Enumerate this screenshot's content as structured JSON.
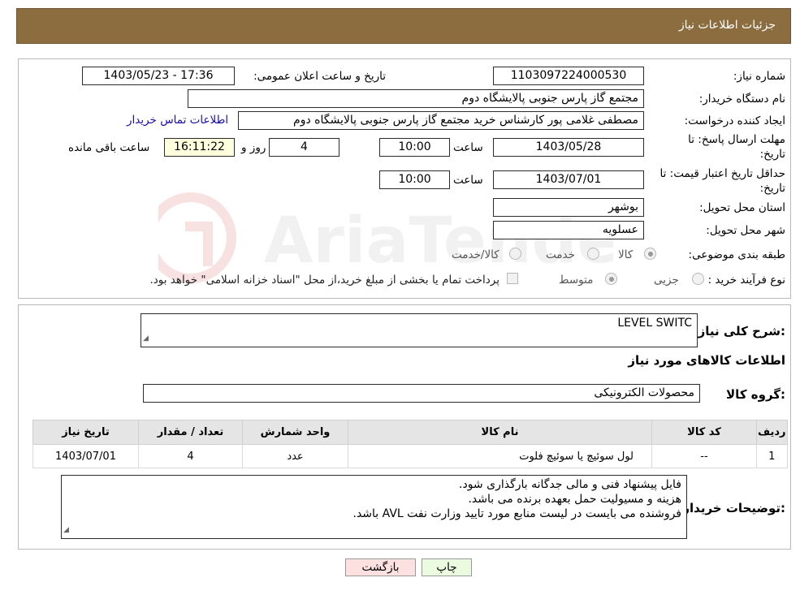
{
  "header": {
    "title": "جزئیات اطلاعات نیاز"
  },
  "form": {
    "need_number_label": "شماره نیاز:",
    "need_number": "1103097224000530",
    "announce_label": "تاریخ و ساعت اعلان عمومی:",
    "announce_value": "1403/05/23 - 17:36",
    "buyer_org_label": "نام دستگاه خریدار:",
    "buyer_org": "مجتمع گاز پارس جنوبی  پالایشگاه دوم",
    "creator_label": "ایجاد کننده درخواست:",
    "creator": "مصطفی غلامی پور کارشناس خرید مجتمع گاز پارس جنوبی  پالایشگاه دوم",
    "contact_link": "اطلاعات تماس خریدار",
    "deadline_label_1": "مهلت ارسال پاسخ: تا",
    "deadline_label_2": "تاریخ:",
    "deadline_date": "1403/05/28",
    "time_label": "ساعت",
    "deadline_time": "10:00",
    "days_value": "4",
    "days_label": "روز و",
    "remaining_time": "16:11:22",
    "remaining_label": "ساعت باقی مانده",
    "validity_label_1": "حداقل تاریخ اعتبار قیمت: تا",
    "validity_label_2": "تاریخ:",
    "validity_date": "1403/07/01",
    "validity_time_label": "ساعت",
    "validity_time": "10:00",
    "province_label": "استان محل تحویل:",
    "province": "بوشهر",
    "city_label": "شهر محل تحویل:",
    "city": "عسلویه",
    "category_label": "طبقه بندی موضوعی:",
    "category_options": [
      "کالا",
      "خدمت",
      "کالا/خدمت"
    ],
    "process_label": "نوع فرآیند خرید :",
    "process_options": [
      "جزیی",
      "متوسط"
    ],
    "process_note": "پرداخت تمام یا بخشی از مبلغ خرید،از محل \"اسناد خزانه اسلامی\" خواهد بود."
  },
  "details": {
    "summary_label": "شرح کلی نیاز:",
    "summary_value": "LEVEL SWITC",
    "goods_info_title": "اطلاعات کالاهای مورد نیاز",
    "group_label": "گروه کالا:",
    "group_value": "محصولات الکترونیکی",
    "table": {
      "headers": [
        "ردیف",
        "کد کالا",
        "نام کالا",
        "واحد شمارش",
        "تعداد / مقدار",
        "تاریخ نیاز"
      ],
      "rows": [
        [
          "1",
          "--",
          "لول سوئیچ یا سوئیچ فلوت",
          "عدد",
          "4",
          "1403/07/01"
        ]
      ]
    },
    "notes_label": "توضیحات خریدار:",
    "notes_lines": [
      "فایل پیشنهاد فنی و مالی جدگانه بارگذاری شود.",
      "هزینه و مسیولیت حمل بعهده برنده می باشد.",
      "فروشنده می بایست در لیست منابع مورد تایید وزارت نفت AVL باشد."
    ]
  },
  "buttons": {
    "back": "بازگشت",
    "print": "چاپ"
  },
  "watermark": {
    "text": "AriaTender.neT"
  },
  "colors": {
    "header_bg": "#8b6d3f",
    "back_btn_bg": "#fde0e0",
    "print_btn_bg": "#eafbe0",
    "remaining_bg": "#ffffdd",
    "link": "#1a0dab"
  }
}
